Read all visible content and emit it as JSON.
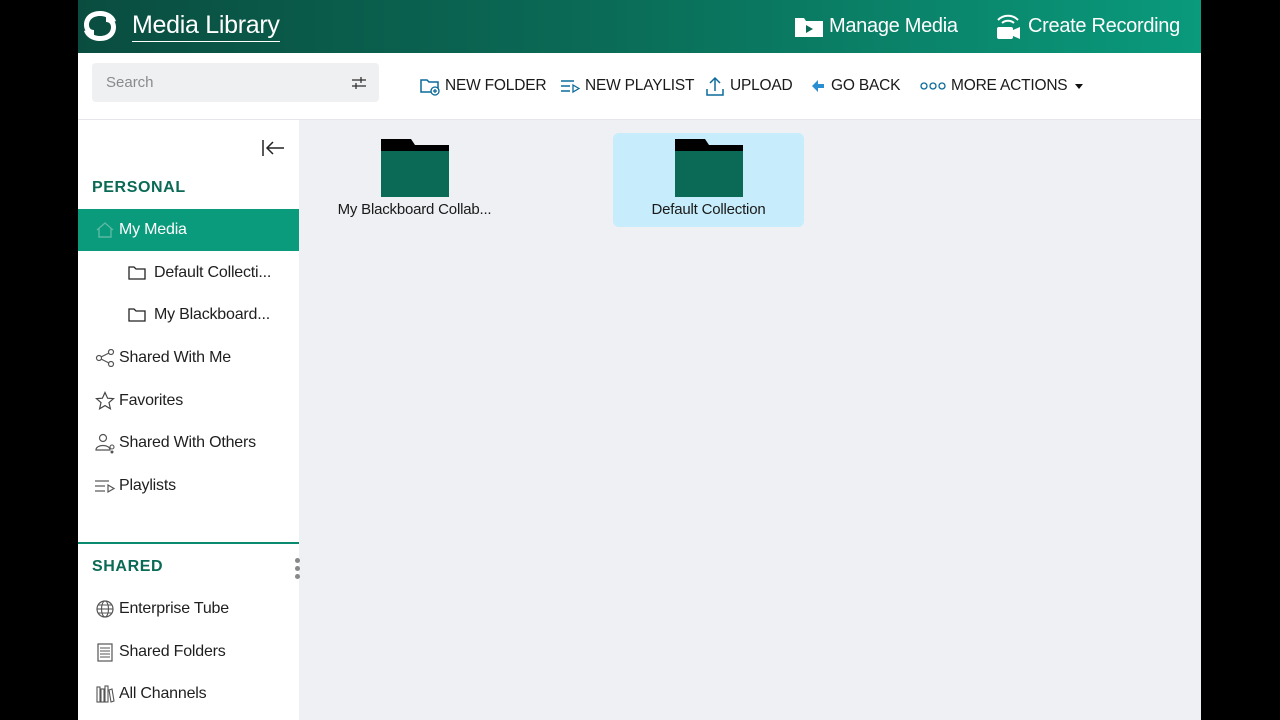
{
  "header": {
    "title": "Media Library",
    "manage_media": "Manage Media",
    "create_recording": "Create Recording"
  },
  "toolbar": {
    "search_placeholder": "Search",
    "new_folder": "NEW FOLDER",
    "new_playlist": "NEW PLAYLIST",
    "upload": "UPLOAD",
    "go_back": "GO BACK",
    "more_actions": "MORE ACTIONS"
  },
  "sidebar": {
    "personal_title": "PERSONAL",
    "personal_items": [
      {
        "label": "My Media",
        "icon": "home-icon",
        "active": true
      },
      {
        "label": "Default Collecti...",
        "icon": "folder-icon"
      },
      {
        "label": "My Blackboard...",
        "icon": "folder-icon"
      },
      {
        "label": "Shared With Me",
        "icon": "share-icon"
      },
      {
        "label": "Favorites",
        "icon": "star-icon"
      },
      {
        "label": "Shared With Others",
        "icon": "user-share-icon"
      },
      {
        "label": "Playlists",
        "icon": "playlist-icon"
      }
    ],
    "shared_title": "SHARED",
    "shared_items": [
      {
        "label": "Enterprise Tube",
        "icon": "globe-icon"
      },
      {
        "label": "Shared Folders",
        "icon": "shared-folder-icon"
      },
      {
        "label": "All Channels",
        "icon": "channels-icon"
      }
    ]
  },
  "content": {
    "folders": [
      {
        "label": "My Blackboard Collab...",
        "selected": false
      },
      {
        "label": "Default Collection",
        "selected": true
      }
    ]
  },
  "colors": {
    "brand": "#0a6a55",
    "active": "#0a9a7c",
    "selected_tile": "#c7ecfb"
  }
}
